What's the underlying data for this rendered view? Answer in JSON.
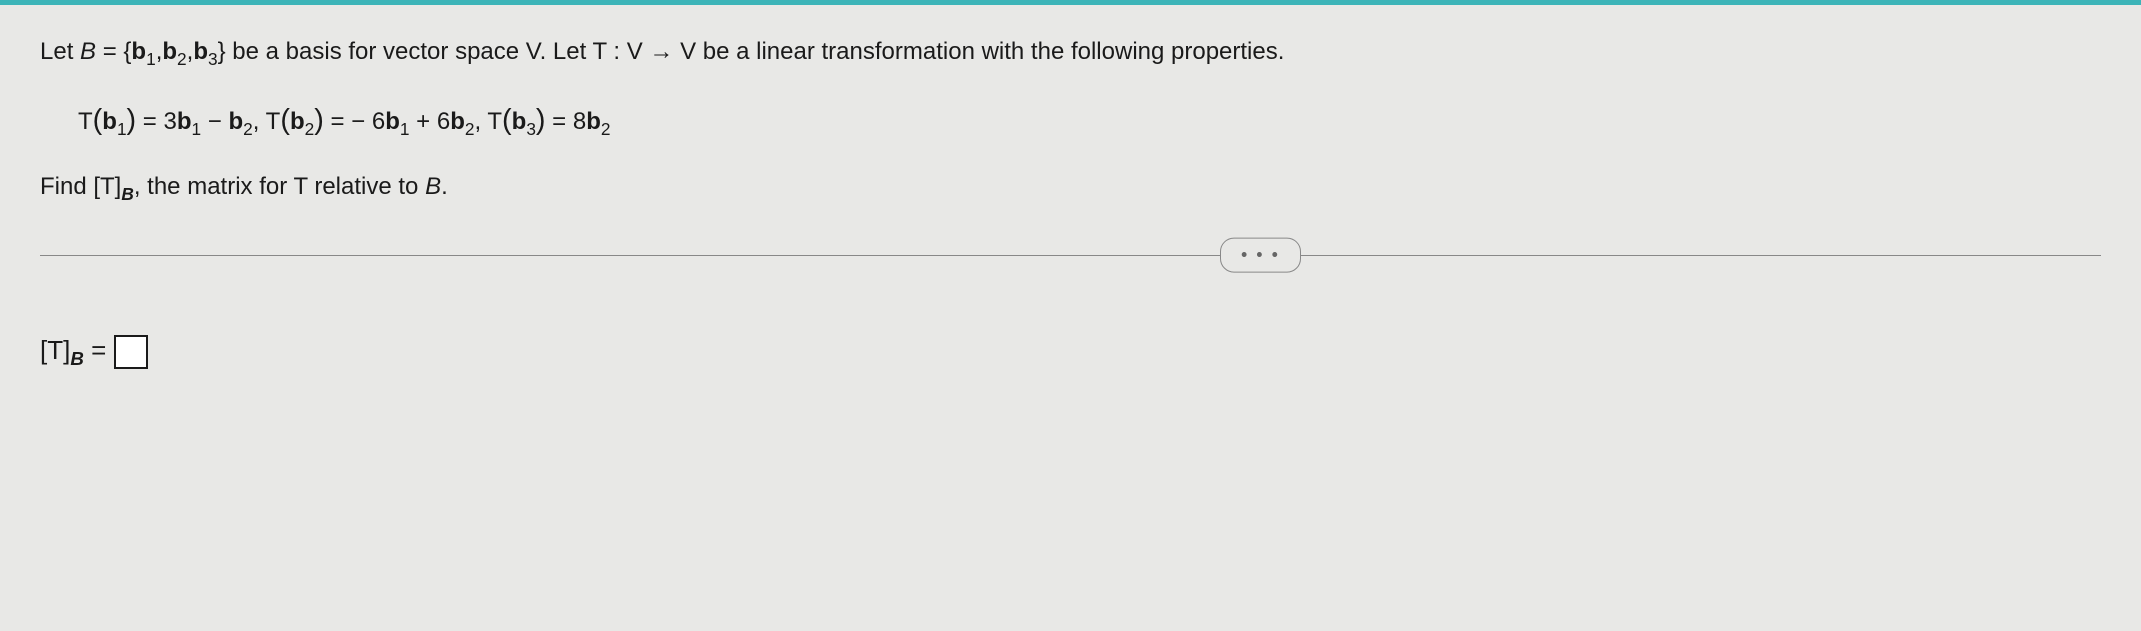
{
  "line1": {
    "prefix": "Let ",
    "B": "B",
    "eq": " = {",
    "b1": "b",
    "s1": "1",
    "comma1": ",",
    "b2": "b",
    "s2": "2",
    "comma2": ",",
    "b3": "b",
    "s3": "3",
    "close": "} be a basis for vector space V. Let T : V → V be a linear transformation with the following properties."
  },
  "line2": {
    "tb1_open": "T",
    "tb1_paren_open": "(",
    "tb1_var": "b",
    "tb1_sub": "1",
    "tb1_paren_close": ")",
    "tb1_eq": " = 3",
    "tb1_r1v": "b",
    "tb1_r1s": "1",
    "tb1_minus": " − ",
    "tb1_r2v": "b",
    "tb1_r2s": "2",
    "sep1": ",   ",
    "tb2_open": "T",
    "tb2_paren_open": "(",
    "tb2_var": "b",
    "tb2_sub": "2",
    "tb2_paren_close": ")",
    "tb2_eq": " = − 6",
    "tb2_r1v": "b",
    "tb2_r1s": "1",
    "tb2_plus": " + 6",
    "tb2_r2v": "b",
    "tb2_r2s": "2",
    "sep2": ",   ",
    "tb3_open": "T",
    "tb3_paren_open": "(",
    "tb3_var": "b",
    "tb3_sub": "3",
    "tb3_paren_close": ")",
    "tb3_eq": " = 8",
    "tb3_r1v": "b",
    "tb3_r1s": "2"
  },
  "line3": {
    "prefix": "Find [T]",
    "sub": "B",
    "suffix": ", the matrix for T relative to ",
    "B": "B",
    "period": "."
  },
  "pill": "• • •",
  "answer": {
    "label_open": "[T]",
    "label_sub": "B",
    "eq": " = "
  }
}
